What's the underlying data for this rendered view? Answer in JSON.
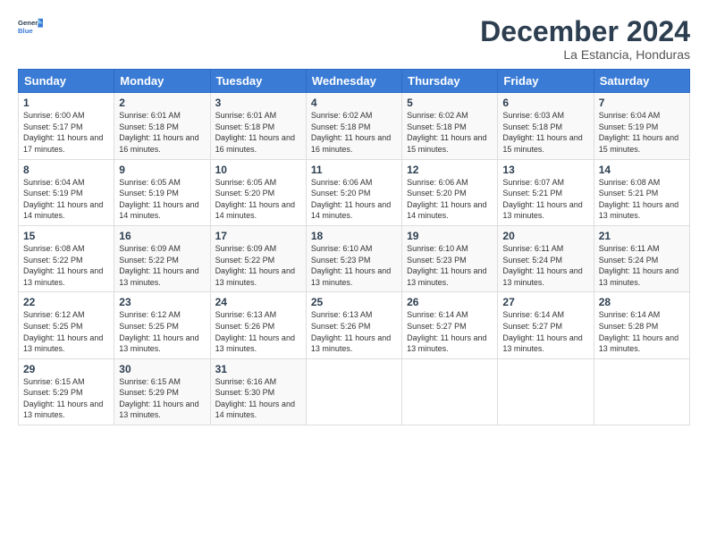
{
  "logo": {
    "line1": "General",
    "line2": "Blue"
  },
  "title": "December 2024",
  "subtitle": "La Estancia, Honduras",
  "days_of_week": [
    "Sunday",
    "Monday",
    "Tuesday",
    "Wednesday",
    "Thursday",
    "Friday",
    "Saturday"
  ],
  "weeks": [
    [
      {
        "day": "1",
        "sunrise": "6:00 AM",
        "sunset": "5:17 PM",
        "daylight": "11 hours and 17 minutes."
      },
      {
        "day": "2",
        "sunrise": "6:01 AM",
        "sunset": "5:18 PM",
        "daylight": "11 hours and 16 minutes."
      },
      {
        "day": "3",
        "sunrise": "6:01 AM",
        "sunset": "5:18 PM",
        "daylight": "11 hours and 16 minutes."
      },
      {
        "day": "4",
        "sunrise": "6:02 AM",
        "sunset": "5:18 PM",
        "daylight": "11 hours and 16 minutes."
      },
      {
        "day": "5",
        "sunrise": "6:02 AM",
        "sunset": "5:18 PM",
        "daylight": "11 hours and 15 minutes."
      },
      {
        "day": "6",
        "sunrise": "6:03 AM",
        "sunset": "5:18 PM",
        "daylight": "11 hours and 15 minutes."
      },
      {
        "day": "7",
        "sunrise": "6:04 AM",
        "sunset": "5:19 PM",
        "daylight": "11 hours and 15 minutes."
      }
    ],
    [
      {
        "day": "8",
        "sunrise": "6:04 AM",
        "sunset": "5:19 PM",
        "daylight": "11 hours and 14 minutes."
      },
      {
        "day": "9",
        "sunrise": "6:05 AM",
        "sunset": "5:19 PM",
        "daylight": "11 hours and 14 minutes."
      },
      {
        "day": "10",
        "sunrise": "6:05 AM",
        "sunset": "5:20 PM",
        "daylight": "11 hours and 14 minutes."
      },
      {
        "day": "11",
        "sunrise": "6:06 AM",
        "sunset": "5:20 PM",
        "daylight": "11 hours and 14 minutes."
      },
      {
        "day": "12",
        "sunrise": "6:06 AM",
        "sunset": "5:20 PM",
        "daylight": "11 hours and 14 minutes."
      },
      {
        "day": "13",
        "sunrise": "6:07 AM",
        "sunset": "5:21 PM",
        "daylight": "11 hours and 13 minutes."
      },
      {
        "day": "14",
        "sunrise": "6:08 AM",
        "sunset": "5:21 PM",
        "daylight": "11 hours and 13 minutes."
      }
    ],
    [
      {
        "day": "15",
        "sunrise": "6:08 AM",
        "sunset": "5:22 PM",
        "daylight": "11 hours and 13 minutes."
      },
      {
        "day": "16",
        "sunrise": "6:09 AM",
        "sunset": "5:22 PM",
        "daylight": "11 hours and 13 minutes."
      },
      {
        "day": "17",
        "sunrise": "6:09 AM",
        "sunset": "5:22 PM",
        "daylight": "11 hours and 13 minutes."
      },
      {
        "day": "18",
        "sunrise": "6:10 AM",
        "sunset": "5:23 PM",
        "daylight": "11 hours and 13 minutes."
      },
      {
        "day": "19",
        "sunrise": "6:10 AM",
        "sunset": "5:23 PM",
        "daylight": "11 hours and 13 minutes."
      },
      {
        "day": "20",
        "sunrise": "6:11 AM",
        "sunset": "5:24 PM",
        "daylight": "11 hours and 13 minutes."
      },
      {
        "day": "21",
        "sunrise": "6:11 AM",
        "sunset": "5:24 PM",
        "daylight": "11 hours and 13 minutes."
      }
    ],
    [
      {
        "day": "22",
        "sunrise": "6:12 AM",
        "sunset": "5:25 PM",
        "daylight": "11 hours and 13 minutes."
      },
      {
        "day": "23",
        "sunrise": "6:12 AM",
        "sunset": "5:25 PM",
        "daylight": "11 hours and 13 minutes."
      },
      {
        "day": "24",
        "sunrise": "6:13 AM",
        "sunset": "5:26 PM",
        "daylight": "11 hours and 13 minutes."
      },
      {
        "day": "25",
        "sunrise": "6:13 AM",
        "sunset": "5:26 PM",
        "daylight": "11 hours and 13 minutes."
      },
      {
        "day": "26",
        "sunrise": "6:14 AM",
        "sunset": "5:27 PM",
        "daylight": "11 hours and 13 minutes."
      },
      {
        "day": "27",
        "sunrise": "6:14 AM",
        "sunset": "5:27 PM",
        "daylight": "11 hours and 13 minutes."
      },
      {
        "day": "28",
        "sunrise": "6:14 AM",
        "sunset": "5:28 PM",
        "daylight": "11 hours and 13 minutes."
      }
    ],
    [
      {
        "day": "29",
        "sunrise": "6:15 AM",
        "sunset": "5:29 PM",
        "daylight": "11 hours and 13 minutes."
      },
      {
        "day": "30",
        "sunrise": "6:15 AM",
        "sunset": "5:29 PM",
        "daylight": "11 hours and 13 minutes."
      },
      {
        "day": "31",
        "sunrise": "6:16 AM",
        "sunset": "5:30 PM",
        "daylight": "11 hours and 14 minutes."
      },
      null,
      null,
      null,
      null
    ]
  ],
  "labels": {
    "sunrise": "Sunrise:",
    "sunset": "Sunset:",
    "daylight": "Daylight:"
  }
}
